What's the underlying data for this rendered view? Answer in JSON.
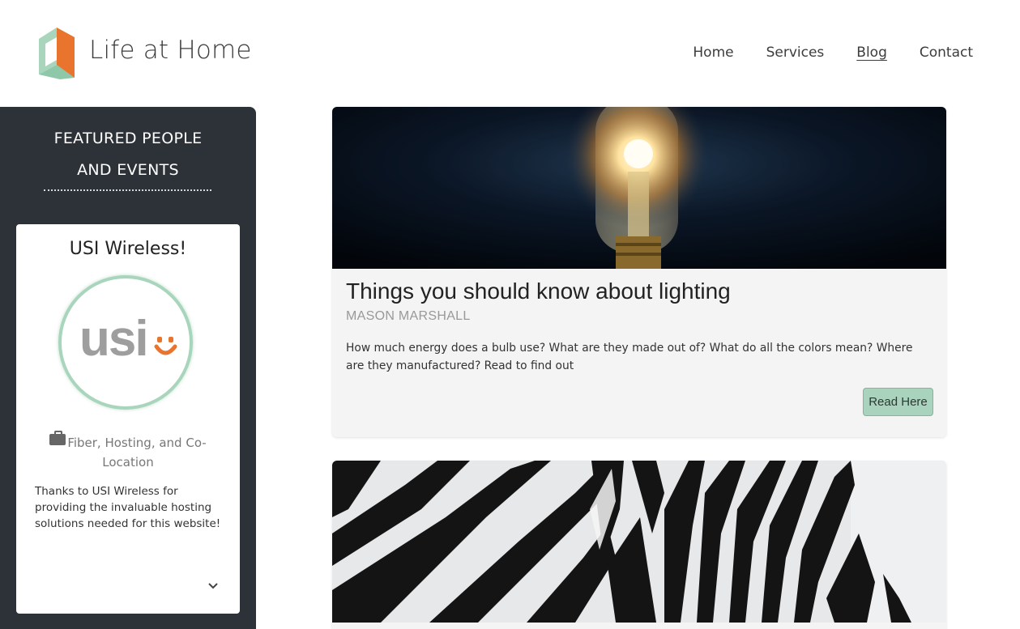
{
  "header": {
    "site_title": "Life at Home",
    "nav": [
      {
        "label": "Home",
        "active": false
      },
      {
        "label": "Services",
        "active": false
      },
      {
        "label": "Blog",
        "active": true
      },
      {
        "label": "Contact",
        "active": false
      }
    ]
  },
  "sidebar": {
    "title_line1": "FEATURED PEOPLE",
    "title_line2": "AND EVENTS",
    "featured": {
      "name": "USI Wireless!",
      "logo_text": "usi",
      "logo_icon": "usi-smile-logo",
      "category_icon": "briefcase-icon",
      "category": "Fiber, Hosting, and Co-Location",
      "description": "Thanks to USI Wireless for providing the invaluable hosting solutions needed for this website!",
      "expand_icon": "chevron-down-icon"
    }
  },
  "posts": [
    {
      "image": "light-bulb-photo",
      "title": "Things you should know about lighting",
      "author": "MASON MARSHALL",
      "excerpt": "How much energy does a bulb use? What are they made out of? What do all the colors mean? Where are they manufactured? Read to find out",
      "button_label": "Read Here"
    },
    {
      "image": "zebra-stripes-photo"
    }
  ],
  "colors": {
    "sidebar_bg": "#2d3238",
    "accent_green": "#a9d3bd",
    "logo_orange": "#e8742e",
    "logo_green": "#a8d5bc",
    "card_bg": "#f4f4f4"
  }
}
